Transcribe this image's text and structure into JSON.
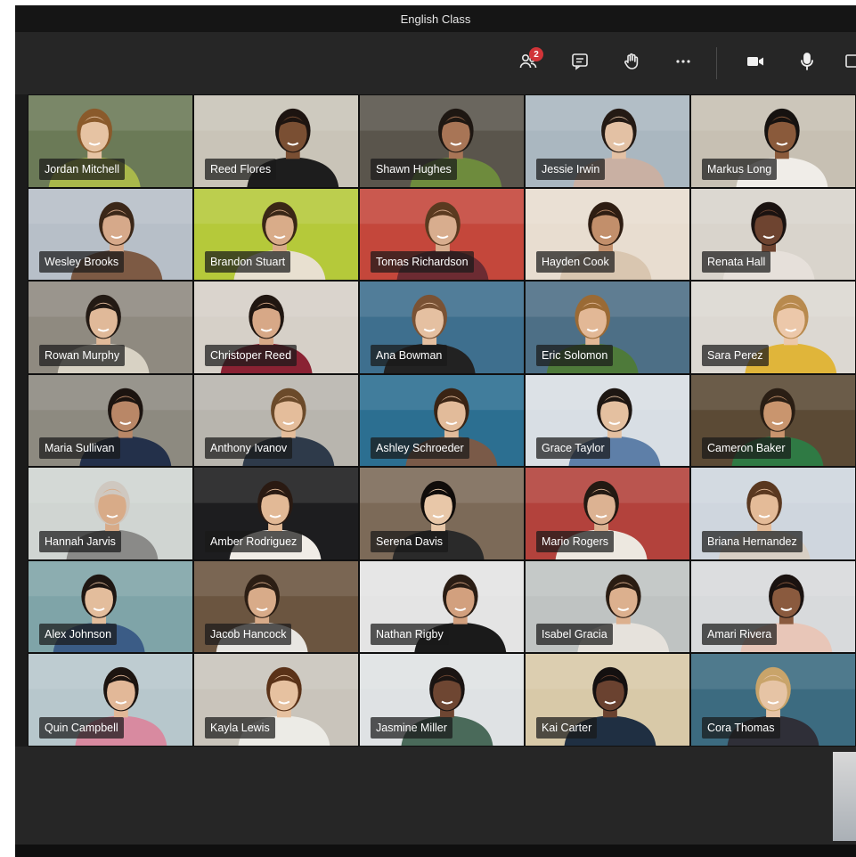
{
  "window": {
    "title": "English Class"
  },
  "toolbar": {
    "participants_badge": "2"
  },
  "colors": {
    "badge": "#d13438",
    "titlebar": "#151515",
    "toolbar": "#262626"
  },
  "participants": [
    {
      "name": "Jordan Mitchell",
      "bg": "#6b7a57",
      "skin": "#e6c3a3",
      "hair": "#8a5a2b",
      "shirt": "#a9b84b"
    },
    {
      "name": "Reed Flores",
      "bg": "#c9c4b8",
      "skin": "#7a4f33",
      "hair": "#1d1410",
      "shirt": "#1d1d1d"
    },
    {
      "name": "Shawn Hughes",
      "bg": "#5a554c",
      "skin": "#a87556",
      "hair": "#1e1712",
      "shirt": "#6e8b3d"
    },
    {
      "name": "Jessie Irwin",
      "bg": "#aab7c0",
      "skin": "#e3c1a4",
      "hair": "#241a14",
      "shirt": "#c9b0a3"
    },
    {
      "name": "Markus Long",
      "bg": "#c7c0b3",
      "skin": "#8a5a3b",
      "hair": "#161210",
      "shirt": "#f0ede8"
    },
    {
      "name": "Wesley Brooks",
      "bg": "#b7bfc8",
      "skin": "#d6a98a",
      "hair": "#3b2718",
      "shirt": "#7d5a44"
    },
    {
      "name": "Brandon Stuart",
      "bg": "#b5c93a",
      "skin": "#d9ac89",
      "hair": "#3a2716",
      "shirt": "#e8e0d0"
    },
    {
      "name": "Tomas Richardson",
      "bg": "#c4473b",
      "skin": "#d8ad8e",
      "hair": "#5a3a20",
      "shirt": "#6c2b32"
    },
    {
      "name": "Hayden Cook",
      "bg": "#e8ddd0",
      "skin": "#c28f6b",
      "hair": "#2e1d12",
      "shirt": "#d9c6b0"
    },
    {
      "name": "Renata Hall",
      "bg": "#d9d4cc",
      "skin": "#6e4430",
      "hair": "#1a1210",
      "shirt": "#e6e0da"
    },
    {
      "name": "Rowan Murphy",
      "bg": "#8f8a80",
      "skin": "#e0b999",
      "hair": "#231a14",
      "shirt": "#d8d2c4"
    },
    {
      "name": "Christoper Reed",
      "bg": "#d6d0c8",
      "skin": "#d7a887",
      "hair": "#201611",
      "shirt": "#8a2233"
    },
    {
      "name": "Ana Bowman",
      "bg": "#3e6f8e",
      "skin": "#e5c0a1",
      "hair": "#7a5234",
      "shirt": "#222222"
    },
    {
      "name": "Eric Solomon",
      "bg": "#4d6f86",
      "skin": "#e2b896",
      "hair": "#9a6a35",
      "shirt": "#4e7a3a"
    },
    {
      "name": "Sara Perez",
      "bg": "#dcd8d2",
      "skin": "#ecc8aa",
      "hair": "#b88a4e",
      "shirt": "#e0b53a"
    },
    {
      "name": "Maria Sullivan",
      "bg": "#8d8a80",
      "skin": "#b98767",
      "hair": "#1c1410",
      "shirt": "#23304a"
    },
    {
      "name": "Anthony Ivanov",
      "bg": "#b8b5ae",
      "skin": "#e4bd9b",
      "hair": "#6b4a2a",
      "shirt": "#2e3a4a"
    },
    {
      "name": "Ashley Schroeder",
      "bg": "#2c6f91",
      "skin": "#e2bb9a",
      "hair": "#3a2414",
      "shirt": "#7a5a48"
    },
    {
      "name": "Grace Taylor",
      "bg": "#d8dee4",
      "skin": "#e4c0a0",
      "hair": "#1d1612",
      "shirt": "#5e7fa8"
    },
    {
      "name": "Cameron Baker",
      "bg": "#5b4a35",
      "skin": "#c9956e",
      "hair": "#2a1e14",
      "shirt": "#2f7a44"
    },
    {
      "name": "Hannah Jarvis",
      "bg": "#d0d5d2",
      "skin": "#d8ab88",
      "hair": "#cfc8c0",
      "shirt": "#8a8a88"
    },
    {
      "name": "Amber Rodriguez",
      "bg": "#1d1d1f",
      "skin": "#e2b996",
      "hair": "#2a1a12",
      "shirt": "#f0ece6"
    },
    {
      "name": "Serena Davis",
      "bg": "#7c6a58",
      "skin": "#e8c7a8",
      "hair": "#100c0a",
      "shirt": "#2a2a2a"
    },
    {
      "name": "Mario Rogers",
      "bg": "#b3423c",
      "skin": "#dcb292",
      "hair": "#231912",
      "shirt": "#ede8e0"
    },
    {
      "name": "Briana Hernandez",
      "bg": "#cfd6de",
      "skin": "#e4bb98",
      "hair": "#5a3820",
      "shirt": "#d8cfc4"
    },
    {
      "name": "Alex Johnson",
      "bg": "#7fa4a8",
      "skin": "#e3bd9c",
      "hair": "#1e1612",
      "shirt": "#3b5c86"
    },
    {
      "name": "Jacob Hancock",
      "bg": "#6b5540",
      "skin": "#d8ab89",
      "hair": "#2c1e14",
      "shirt": "#e8e6e2"
    },
    {
      "name": "Nathan Rigby",
      "bg": "#e4e4e4",
      "skin": "#d2a07e",
      "hair": "#2a1d14",
      "shirt": "#1a1a1a"
    },
    {
      "name": "Isabel Gracia",
      "bg": "#bfc3c2",
      "skin": "#dcb08e",
      "hair": "#2a1c12",
      "shirt": "#e6e2dc"
    },
    {
      "name": "Amari Rivera",
      "bg": "#d8dadc",
      "skin": "#8a5a3e",
      "hair": "#1a1210",
      "shirt": "#e8c6b8"
    },
    {
      "name": "Quin Campbell",
      "bg": "#b7c7cc",
      "skin": "#e2b898",
      "hair": "#1c1410",
      "shirt": "#d88aa0"
    },
    {
      "name": "Kayla Lewis",
      "bg": "#c9c4bb",
      "skin": "#e6c1a0",
      "hair": "#5a3218",
      "shirt": "#ecebe6"
    },
    {
      "name": "Jasmine Miller",
      "bg": "#dfe2e4",
      "skin": "#6e4632",
      "hair": "#1a1412",
      "shirt": "#4a6a5a"
    },
    {
      "name": "Kai Carter",
      "bg": "#d8c9a8",
      "skin": "#6a4230",
      "hair": "#141010",
      "shirt": "#1f2f42"
    },
    {
      "name": "Cora Thomas",
      "bg": "#3c6b80",
      "skin": "#e6c4a5",
      "hair": "#c9a46a",
      "shirt": "#2f2f38"
    }
  ]
}
